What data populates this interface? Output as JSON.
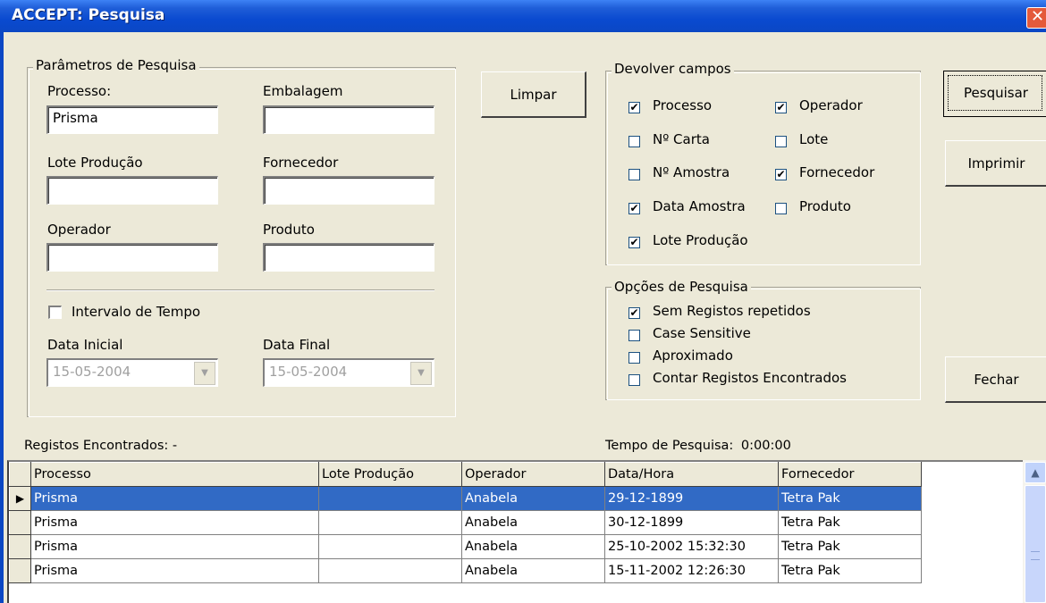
{
  "window": {
    "title": "ACCEPT: Pesquisa"
  },
  "params": {
    "group_label": "Parâmetros de Pesquisa",
    "processo_label": "Processo:",
    "processo_value": "Prisma",
    "embalagem_label": "Embalagem",
    "embalagem_value": "",
    "lote_label": "Lote Produção",
    "lote_value": "",
    "fornecedor_label": "Fornecedor",
    "fornecedor_value": "",
    "operador_label": "Operador",
    "operador_value": "",
    "produto_label": "Produto",
    "produto_value": "",
    "intervalo_label": "Intervalo de Tempo",
    "intervalo_checked": false,
    "data_inicial_label": "Data Inicial",
    "data_inicial_value": "15-05-2004",
    "data_final_label": "Data Final",
    "data_final_value": "15-05-2004"
  },
  "buttons": {
    "limpar": "Limpar",
    "pesquisar": "Pesquisar",
    "imprimir": "Imprimir",
    "fechar": "Fechar"
  },
  "devolver": {
    "group_label": "Devolver campos",
    "fields": [
      {
        "label": "Processo",
        "checked": true
      },
      {
        "label": "Operador",
        "checked": true
      },
      {
        "label": "Nº Carta",
        "checked": false
      },
      {
        "label": "Lote",
        "checked": false
      },
      {
        "label": "Nº Amostra",
        "checked": false
      },
      {
        "label": "Fornecedor",
        "checked": true
      },
      {
        "label": "Data Amostra",
        "checked": true
      },
      {
        "label": "Produto",
        "checked": false
      },
      {
        "label": "Lote Produção",
        "checked": true
      }
    ]
  },
  "opcoes": {
    "group_label": "Opções de Pesquisa",
    "items": [
      {
        "label": "Sem Registos repetidos",
        "checked": true
      },
      {
        "label": "Case Sensitive",
        "checked": false
      },
      {
        "label": "Aproximado",
        "checked": false
      },
      {
        "label": "Contar Registos Encontrados",
        "checked": false
      }
    ]
  },
  "status": {
    "registos_label": "Registos Encontrados:",
    "registos_value": "-",
    "tempo_label": "Tempo de Pesquisa:",
    "tempo_value": "0:00:00"
  },
  "grid": {
    "columns": [
      "Processo",
      "Lote Produção",
      "Operador",
      "Data/Hora",
      "Fornecedor"
    ],
    "rows": [
      [
        "Prisma",
        "",
        "Anabela",
        "29-12-1899",
        "Tetra Pak"
      ],
      [
        "Prisma",
        "",
        "Anabela",
        "30-12-1899",
        "Tetra Pak"
      ],
      [
        "Prisma",
        "",
        "Anabela",
        "25-10-2002 15:32:30",
        "Tetra Pak"
      ],
      [
        "Prisma",
        "",
        "Anabela",
        "15-11-2002 12:26:30",
        "Tetra Pak"
      ]
    ],
    "selected_row": 0,
    "current_row_marker": "▶"
  },
  "icons": {
    "close": "close-icon",
    "checkmark": "✔",
    "combo_arrow": "▼",
    "scroll_up": "▲"
  },
  "colors": {
    "titlebar": "#0b47c4",
    "selection": "#316ac5",
    "dialog_bg": "#ece9d8"
  }
}
